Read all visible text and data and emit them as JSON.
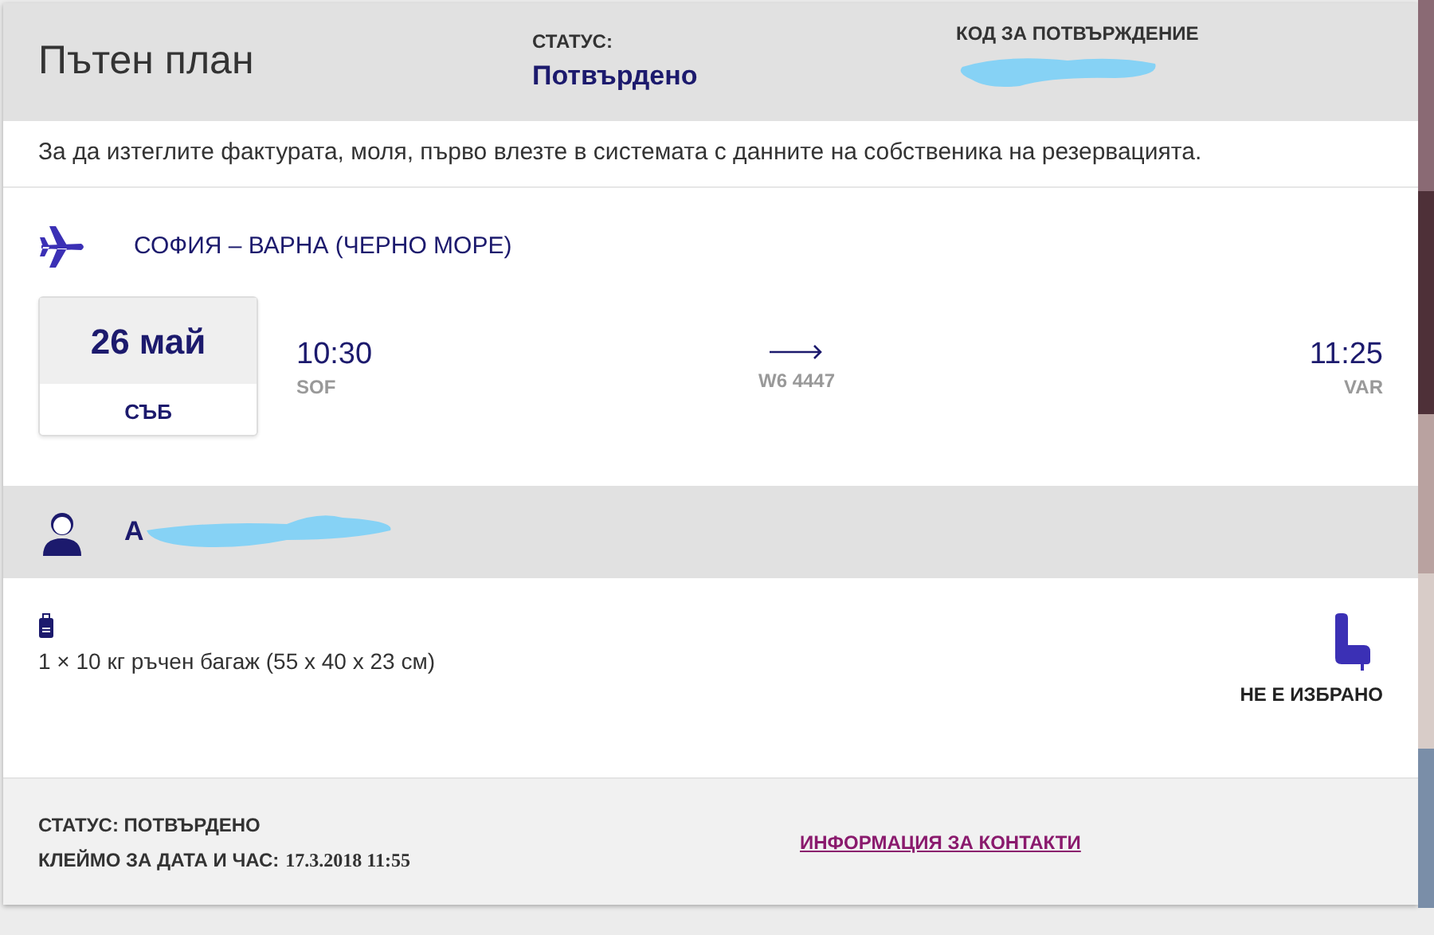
{
  "header": {
    "title": "Пътен план",
    "status_label": "СТАТУС:",
    "status_value": "Потвърдено",
    "code_label": "КОД ЗА ПОТВЪРЖДЕНИЕ"
  },
  "notice": "За да изтеглите фактурата, моля, първо влезте в системата с данните на собственика на резервацията.",
  "flight": {
    "route": "СОФИЯ – ВАРНА (ЧЕРНО МОРЕ)",
    "date": "26 май",
    "weekday": "СЪБ",
    "departure_time": "10:30",
    "departure_airport": "SOF",
    "flight_number": "W6 4447",
    "arrival_time": "11:25",
    "arrival_airport": "VAR"
  },
  "passenger": {
    "name": "A"
  },
  "services": {
    "baggage": "1 × 10 кг ръчен багаж (55 x 40 x 23 см)",
    "seat": "НЕ Е ИЗБРАНО"
  },
  "footer": {
    "status": "СТАТУС: ПОТВЪРДЕНО",
    "timestamp_label": "КЛЕЙМО ЗА ДАТА И ЧАС:",
    "timestamp_value": "17.3.2018 11:55",
    "contact_link": "ИНФОРМАЦИЯ ЗА КОНТАКТИ"
  }
}
